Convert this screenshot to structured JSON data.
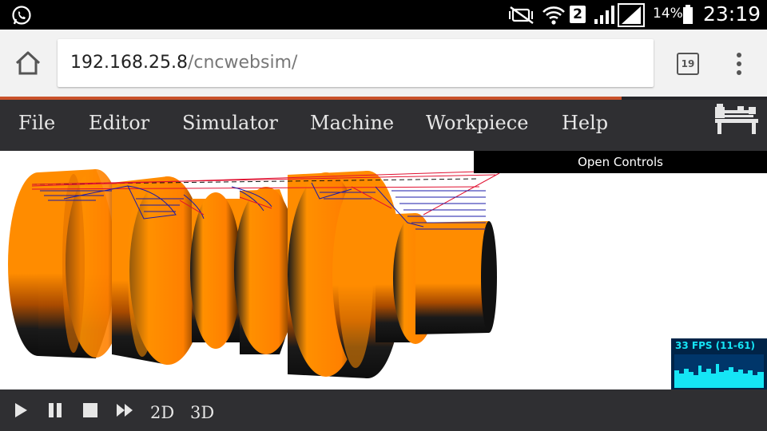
{
  "status_bar": {
    "sim_slot": "2",
    "battery": "14%",
    "time": "23:19",
    "icons": [
      "whatsapp-icon",
      "mute-icon",
      "wifi-icon",
      "signal-icon",
      "battery-icon"
    ]
  },
  "browser": {
    "url_host": "192.168.25.8",
    "url_path": "/cncwebsim/",
    "tab_count": "19",
    "load_progress": 0.81
  },
  "menu": {
    "items": [
      "File",
      "Editor",
      "Simulator",
      "Machine",
      "Workpiece",
      "Help"
    ]
  },
  "canvas": {
    "open_controls_label": "Open Controls",
    "fps_label": "33 FPS (11-61)",
    "colors": {
      "workpiece": "#ff8c00",
      "toolpath_blue": "#1a1aa8",
      "toolpath_red": "#e01030",
      "fps_bg": "#002448",
      "fps_fg": "#15e5f5"
    }
  },
  "player": {
    "controls": [
      "play-icon",
      "pause-icon",
      "stop-icon",
      "fast-forward-icon"
    ],
    "view_2d": "2D",
    "view_3d": "3D"
  }
}
